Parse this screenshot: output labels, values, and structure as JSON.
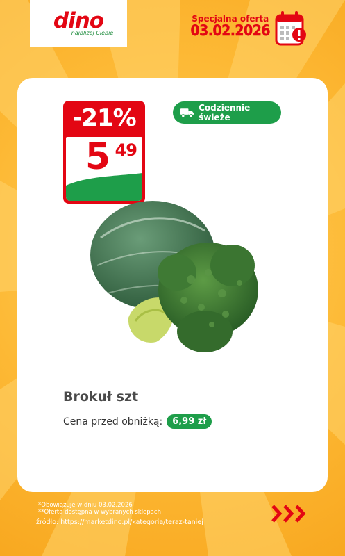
{
  "brand": {
    "name": "dino",
    "tagline": "najbliżej Ciebie",
    "color": "#e30613"
  },
  "promo": {
    "title": "Specjalna oferta",
    "date": "03.02.2026",
    "icon": "calendar-alert-icon"
  },
  "product": {
    "discount": "-21%",
    "price_int": "5",
    "price_dec": "49",
    "badge": "Codziennie świeże",
    "badge_icon": "truck-icon",
    "name": "Brokuł szt",
    "prev_label": "Cena przed obniżką:",
    "prev_price": "6,99 zł",
    "image": "broccoli-image"
  },
  "footer": {
    "line1": "*Obowiązuje w dniu 03.02.2026",
    "line2": "**Oferta dostępna w wybranych sklepach",
    "line3": "źródło: https://marketdino.pl/kategoria/teraz-taniej",
    "next_icon": "triple-chevron-right-icon"
  },
  "colors": {
    "accent_red": "#e30613",
    "accent_green": "#1e9e4a",
    "background": "#fdb935"
  }
}
